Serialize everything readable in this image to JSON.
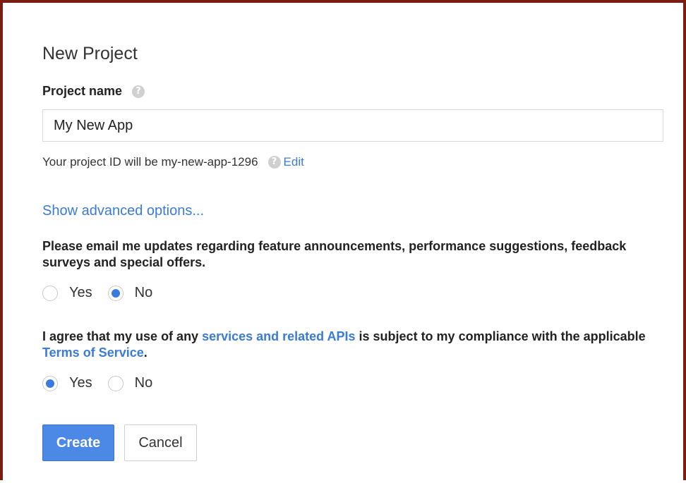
{
  "dialog": {
    "title": "New Project",
    "project_name_label": "Project name",
    "project_name_value": "My New App",
    "project_id_text": "Your project ID will be my-new-app-1296",
    "edit_link": "Edit",
    "advanced_link": "Show advanced options...",
    "email_question": "Please email me updates regarding feature announcements, performance suggestions, feedback surveys and special offers.",
    "email_options": [
      {
        "label": "Yes",
        "selected": false
      },
      {
        "label": "No",
        "selected": true
      }
    ],
    "terms_text_1": "I agree that my use of any ",
    "terms_link_1": "services and related APIs",
    "terms_text_2": " is subject to my compliance with the applicable ",
    "terms_link_2": "Terms of Service",
    "terms_text_3": ".",
    "terms_options": [
      {
        "label": "Yes",
        "selected": true
      },
      {
        "label": "No",
        "selected": false
      }
    ],
    "create_label": "Create",
    "cancel_label": "Cancel"
  },
  "colors": {
    "frame_border": "#7a1d12",
    "link": "#3a7bd5",
    "primary_button": "#4c88e5",
    "radio_checked": "#3b7be0"
  },
  "icons": {
    "help": "question-mark-circle"
  }
}
